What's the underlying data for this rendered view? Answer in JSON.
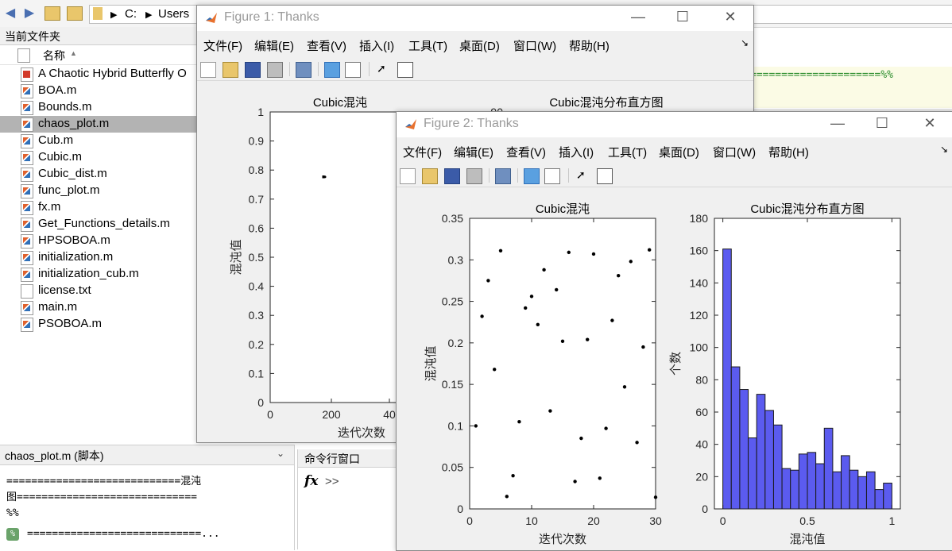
{
  "main_window": {
    "address": {
      "drive": "C:",
      "folder": "Users"
    }
  },
  "file_browser": {
    "title": "当前文件夹",
    "column_header": "名称",
    "files": [
      {
        "name": "A Chaotic Hybrid Butterfly O",
        "type": "pdf"
      },
      {
        "name": "BOA.m",
        "type": "m"
      },
      {
        "name": "Bounds.m",
        "type": "m"
      },
      {
        "name": "chaos_plot.m",
        "type": "m",
        "selected": true
      },
      {
        "name": "Cub.m",
        "type": "m"
      },
      {
        "name": "Cubic.m",
        "type": "m"
      },
      {
        "name": "Cubic_dist.m",
        "type": "m"
      },
      {
        "name": "func_plot.m",
        "type": "m"
      },
      {
        "name": "fx.m",
        "type": "m"
      },
      {
        "name": "Get_Functions_details.m",
        "type": "m"
      },
      {
        "name": "HPSOBOA.m",
        "type": "m"
      },
      {
        "name": "initialization.m",
        "type": "m"
      },
      {
        "name": "initialization_cub.m",
        "type": "m"
      },
      {
        "name": "license.txt",
        "type": "txt"
      },
      {
        "name": "main.m",
        "type": "m"
      },
      {
        "name": "PSOBOA.m",
        "type": "m"
      }
    ]
  },
  "editor_strip": {
    "text": "=====================%%"
  },
  "details": {
    "title": "chaos_plot.m  (脚本)",
    "line1": "============================混沌",
    "line2": "图=============================",
    "line3": "%%",
    "line4": "============================..."
  },
  "command_window": {
    "title": "命令行窗口",
    "prompt": "fx  >>"
  },
  "figure1": {
    "title": "Figure 1: Thanks",
    "menu": [
      "文件(F)",
      "编辑(E)",
      "查看(V)",
      "插入(I)",
      "工具(T)",
      "桌面(D)",
      "窗口(W)",
      "帮助(H)"
    ],
    "left_title": "Cubic混沌",
    "right_title": "Cubic混沌分布直方图",
    "xlabel": "迭代次数",
    "ylabel": "混沌值",
    "yticks": [
      "0",
      "0.1",
      "0.2",
      "0.3",
      "0.4",
      "0.5",
      "0.6",
      "0.7",
      "0.8",
      "0.9",
      "1"
    ],
    "xticks": [
      "0",
      "200",
      "40"
    ],
    "right_ytick_top": "90"
  },
  "figure2": {
    "title": "Figure 2: Thanks",
    "menu": [
      "文件(F)",
      "编辑(E)",
      "查看(V)",
      "插入(I)",
      "工具(T)",
      "桌面(D)",
      "窗口(W)",
      "帮助(H)"
    ]
  },
  "chart_data": [
    {
      "type": "scatter",
      "title": "Cubic混沌",
      "xlabel": "迭代次数",
      "ylabel": "混沌值",
      "xlim": [
        0,
        30
      ],
      "ylim": [
        0,
        0.35
      ],
      "xticks": [
        0,
        10,
        20,
        30
      ],
      "yticks": [
        0,
        0.05,
        0.1,
        0.15,
        0.2,
        0.25,
        0.3,
        0.35
      ],
      "x": [
        1,
        2,
        3,
        4,
        5,
        6,
        7,
        8,
        9,
        10,
        11,
        12,
        13,
        14,
        15,
        16,
        17,
        18,
        19,
        20,
        21,
        22,
        23,
        24,
        25,
        26,
        27,
        28,
        29,
        30
      ],
      "y": [
        0.1,
        0.232,
        0.275,
        0.168,
        0.311,
        0.015,
        0.04,
        0.105,
        0.242,
        0.256,
        0.222,
        0.288,
        0.118,
        0.264,
        0.202,
        0.309,
        0.033,
        0.085,
        0.204,
        0.307,
        0.037,
        0.097,
        0.227,
        0.281,
        0.147,
        0.298,
        0.08,
        0.195,
        0.312,
        0.014
      ]
    },
    {
      "type": "bar",
      "title": "Cubic混沌分布直方图",
      "xlabel": "混沌值",
      "ylabel": "个数",
      "xlim": [
        0,
        1
      ],
      "ylim": [
        0,
        180
      ],
      "xticks": [
        0,
        0.5,
        1
      ],
      "yticks": [
        0,
        20,
        40,
        60,
        80,
        100,
        120,
        140,
        160,
        180
      ],
      "bin_width": 0.05,
      "values": [
        161,
        88,
        74,
        44,
        71,
        61,
        52,
        25,
        24,
        34,
        35,
        28,
        50,
        23,
        33,
        24,
        20,
        23,
        12,
        16
      ],
      "color": "#5b5bef"
    }
  ]
}
